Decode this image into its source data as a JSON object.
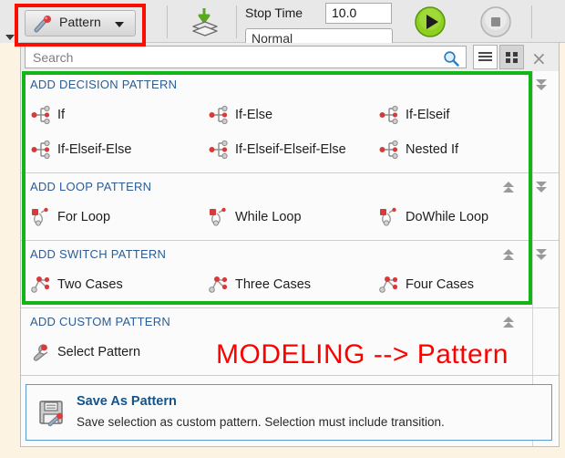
{
  "toolbar": {
    "pattern_button_label": "Pattern",
    "pattern_icon": "pushpin-icon",
    "layers_icon": "apply-layers-icon",
    "stop_time_label": "Stop Time",
    "stop_time_value": "10.0",
    "sim_mode_value": "Normal",
    "run_button": "run-icon",
    "stop_button": "stop-icon"
  },
  "search": {
    "placeholder": "Search",
    "magnifier_icon": "search-icon",
    "list_view_icon": "list-view-icon",
    "grid_view_icon": "grid-view-icon",
    "close_label": "×"
  },
  "sections": [
    {
      "title": "ADD DECISION PATTERN",
      "icon": "decision-pattern-icon",
      "rows": [
        [
          "If",
          "If-Else",
          "If-Elseif"
        ],
        [
          "If-Elseif-Else",
          "If-Elseif-Elseif-Else",
          "Nested If"
        ]
      ]
    },
    {
      "title": "ADD LOOP PATTERN",
      "icon": "loop-pattern-icon",
      "rows": [
        [
          "For Loop",
          "While Loop",
          "DoWhile Loop"
        ]
      ]
    },
    {
      "title": "ADD SWITCH PATTERN",
      "icon": "switch-pattern-icon",
      "rows": [
        [
          "Two Cases",
          "Three Cases",
          "Four Cases"
        ]
      ]
    },
    {
      "title": "ADD CUSTOM PATTERN",
      "icon": "select-pattern-icon",
      "rows": [
        [
          "Select Pattern"
        ]
      ]
    }
  ],
  "save_card": {
    "icon": "save-as-pattern-icon",
    "title": "Save As Pattern",
    "description": "Save selection as custom pattern. Selection must include transition."
  },
  "annotation": {
    "text": "MODELING --> Pattern",
    "color": "#ff0000"
  },
  "highlights": {
    "red_box_color": "#fb0d00",
    "green_box_color": "#14b518"
  }
}
